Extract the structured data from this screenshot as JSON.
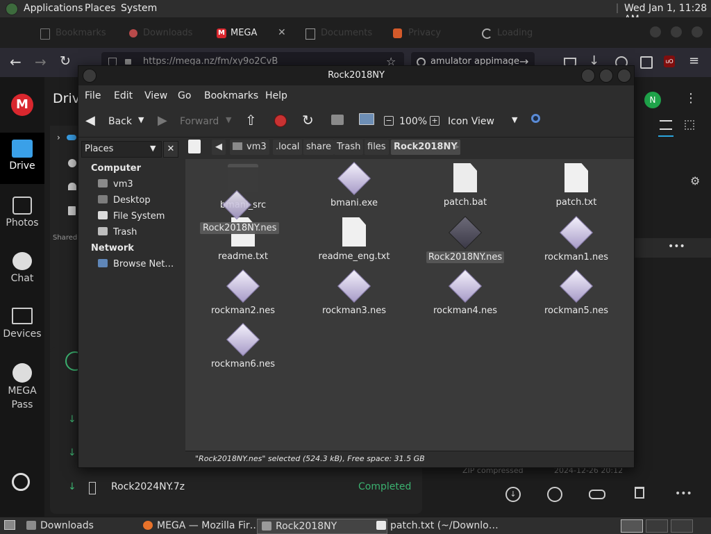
{
  "top_panel": {
    "menus": [
      "Applications",
      "Places",
      "System"
    ],
    "clock": "Wed Jan  1, 11:28 AM"
  },
  "browser": {
    "tabs": [
      {
        "label": "Bookmarks",
        "active": false
      },
      {
        "label": "Downloads",
        "active": false
      },
      {
        "label": "MEGA",
        "active": true
      },
      {
        "label": "Documents",
        "active": false
      },
      {
        "label": "Privacy",
        "active": false
      },
      {
        "label": "Loading",
        "active": false
      }
    ],
    "url": "https://mega.nz/fm/xy9o2CvB",
    "search": "amulator appimage"
  },
  "mega": {
    "section_title": "Drive",
    "nav": [
      "Drive",
      "Photos",
      "Chat",
      "Devices",
      "MEGA Pass"
    ],
    "avatar_letter": "N",
    "shared_label": "Shared",
    "transfer": {
      "name": "Rock2024NY.7z",
      "status": "Completed"
    },
    "bg_row_text": "ZIP compressed",
    "bg_row_date": "2024-12-26 20:12"
  },
  "fm": {
    "title": "Rock2018NY",
    "menu": [
      "File",
      "Edit",
      "View",
      "Go",
      "Bookmarks",
      "Help"
    ],
    "toolbar": {
      "back": "Back",
      "forward": "Forward",
      "zoom": "100%",
      "view_mode": "Icon View"
    },
    "sidebar_mode": "Places",
    "sidebar": {
      "computer_heading": "Computer",
      "computer_items": [
        "vm3",
        "Desktop",
        "File System",
        "Trash"
      ],
      "network_heading": "Network",
      "network_items": [
        "Browse Net…"
      ]
    },
    "path": [
      "vm3",
      ".local",
      "share",
      "Trash",
      "files",
      "Rock2018NY"
    ],
    "files": [
      {
        "name": "bmani_src",
        "kind": "folder"
      },
      {
        "name": "bmani.exe",
        "kind": "gem"
      },
      {
        "name": "patch.bat",
        "kind": "docgem"
      },
      {
        "name": "patch.txt",
        "kind": "doc"
      },
      {
        "name": "readme.txt",
        "kind": "doc"
      },
      {
        "name": "readme_eng.txt",
        "kind": "doc"
      },
      {
        "name": "Rock2018NY.nes",
        "kind": "darkgem"
      },
      {
        "name": "rockman1.nes",
        "kind": "gem"
      },
      {
        "name": "rockman2.nes",
        "kind": "gem"
      },
      {
        "name": "rockman3.nes",
        "kind": "gem"
      },
      {
        "name": "rockman4.nes",
        "kind": "gem"
      },
      {
        "name": "rockman5.nes",
        "kind": "gem"
      },
      {
        "name": "rockman6.nes",
        "kind": "gem"
      }
    ],
    "drag_ghost_label": "Rock2018NY.nes",
    "status": "\"Rock2018NY.nes\" selected (524.3 kB), Free space: 31.5 GB"
  },
  "taskbar": {
    "items": [
      {
        "label": "Downloads"
      },
      {
        "label": "MEGA — Mozilla Fir…"
      },
      {
        "label": "Rock2018NY"
      },
      {
        "label": "patch.txt (~/Downlo…"
      }
    ]
  }
}
